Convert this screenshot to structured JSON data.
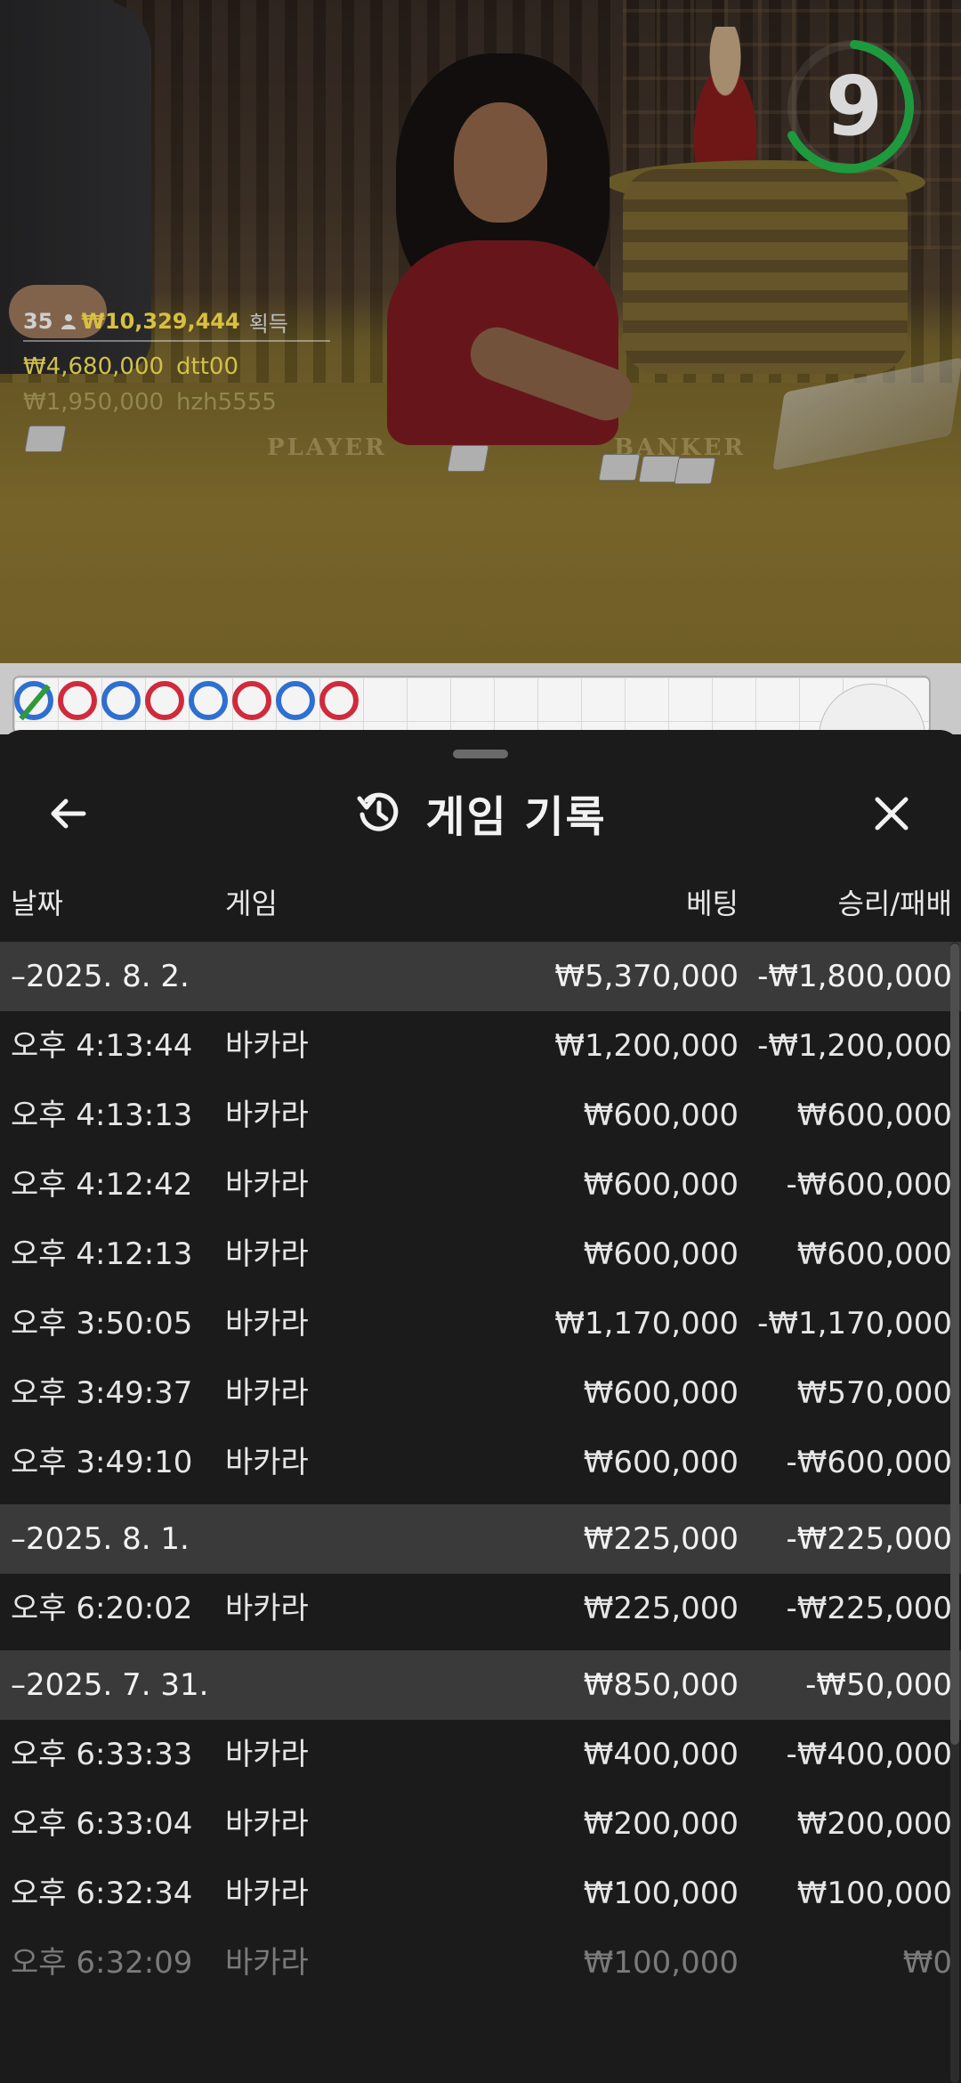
{
  "video": {
    "timer_value": "9",
    "timer_color": "#1e9a3e",
    "table_labels": [
      "PLAYER",
      "BANKER"
    ],
    "win_summary": {
      "count": "35",
      "icon": "person-icon",
      "amount": "₩10,329,444",
      "label": "획득"
    },
    "winners": [
      {
        "amount": "₩4,680,000",
        "name": "dtt00"
      },
      {
        "amount": "₩1,950,000",
        "name": "hzh5555"
      }
    ]
  },
  "roadmap": {
    "beads": [
      "blue-green-slash",
      "red",
      "blue",
      "red",
      "blue",
      "red",
      "blue",
      "red"
    ],
    "colors": {
      "player": "#2f6fd0",
      "banker": "#cf2b3c",
      "tie": "#2e9a3a"
    },
    "toggle_icon": "chevron-up-icon"
  },
  "sheet": {
    "title": "게임 기록",
    "title_icon": "history-icon",
    "back_icon": "arrow-left-icon",
    "close_icon": "close-icon",
    "columns": {
      "date": "날짜",
      "game": "게임",
      "bet": "베팅",
      "result": "승리/패배"
    },
    "rows": [
      {
        "type": "group",
        "date": "–2025. 8. 2.",
        "game": "",
        "bet": "₩5,370,000",
        "result": "-₩1,800,000"
      },
      {
        "type": "item",
        "date": "오후 4:13:44",
        "game": "바카라",
        "bet": "₩1,200,000",
        "result": "-₩1,200,000"
      },
      {
        "type": "item",
        "date": "오후 4:13:13",
        "game": "바카라",
        "bet": "₩600,000",
        "result": "₩600,000"
      },
      {
        "type": "item",
        "date": "오후 4:12:42",
        "game": "바카라",
        "bet": "₩600,000",
        "result": "-₩600,000"
      },
      {
        "type": "item",
        "date": "오후 4:12:13",
        "game": "바카라",
        "bet": "₩600,000",
        "result": "₩600,000"
      },
      {
        "type": "item",
        "date": "오후 3:50:05",
        "game": "바카라",
        "bet": "₩1,170,000",
        "result": "-₩1,170,000"
      },
      {
        "type": "item",
        "date": "오후 3:49:37",
        "game": "바카라",
        "bet": "₩600,000",
        "result": "₩570,000"
      },
      {
        "type": "item",
        "date": "오후 3:49:10",
        "game": "바카라",
        "bet": "₩600,000",
        "result": "-₩600,000"
      },
      {
        "type": "group",
        "date": "–2025. 8. 1.",
        "game": "",
        "bet": "₩225,000",
        "result": "-₩225,000"
      },
      {
        "type": "item",
        "date": "오후 6:20:02",
        "game": "바카라",
        "bet": "₩225,000",
        "result": "-₩225,000"
      },
      {
        "type": "group",
        "date": "–2025. 7. 31.",
        "game": "",
        "bet": "₩850,000",
        "result": "-₩50,000"
      },
      {
        "type": "item",
        "date": "오후 6:33:33",
        "game": "바카라",
        "bet": "₩400,000",
        "result": "-₩400,000"
      },
      {
        "type": "item",
        "date": "오후 6:33:04",
        "game": "바카라",
        "bet": "₩200,000",
        "result": "₩200,000"
      },
      {
        "type": "item",
        "date": "오후 6:32:34",
        "game": "바카라",
        "bet": "₩100,000",
        "result": "₩100,000"
      },
      {
        "type": "item",
        "date": "오후 6:32:09",
        "game": "바카라",
        "bet": "₩100,000",
        "result": "₩0"
      }
    ]
  }
}
